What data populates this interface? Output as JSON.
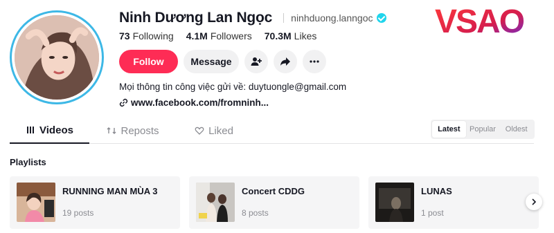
{
  "profile": {
    "display_name": "Ninh Dương Lan Ngọc",
    "username": "ninhduong.lanngoc",
    "stats": [
      {
        "value": "73",
        "label": "Following"
      },
      {
        "value": "4.1M",
        "label": "Followers"
      },
      {
        "value": "70.3M",
        "label": "Likes"
      }
    ],
    "follow_label": "Follow",
    "message_label": "Message",
    "bio": "Mọi thông tin công việc gửi về: duytuongle@gmail.com",
    "link": "www.facebook.com/fromninh..."
  },
  "logo": {
    "text": "VSAO"
  },
  "tabs": [
    {
      "label": "Videos",
      "icon": "grid-icon",
      "active": true
    },
    {
      "label": "Reposts",
      "icon": "repost-icon",
      "active": false
    },
    {
      "label": "Liked",
      "icon": "heart-icon",
      "active": false
    }
  ],
  "sort": [
    {
      "label": "Latest",
      "active": true
    },
    {
      "label": "Popular",
      "active": false
    },
    {
      "label": "Oldest",
      "active": false
    }
  ],
  "playlists": {
    "title": "Playlists",
    "items": [
      {
        "title": "RUNNING MAN MÙA 3",
        "count": "19 posts"
      },
      {
        "title": "Concert CDDG",
        "count": "8 posts"
      },
      {
        "title": "LUNAS",
        "count": "1 post"
      }
    ]
  },
  "colors": {
    "accent": "#fe2c55",
    "verified": "#20d5ec",
    "avatar_ring": "#3db8e6"
  }
}
